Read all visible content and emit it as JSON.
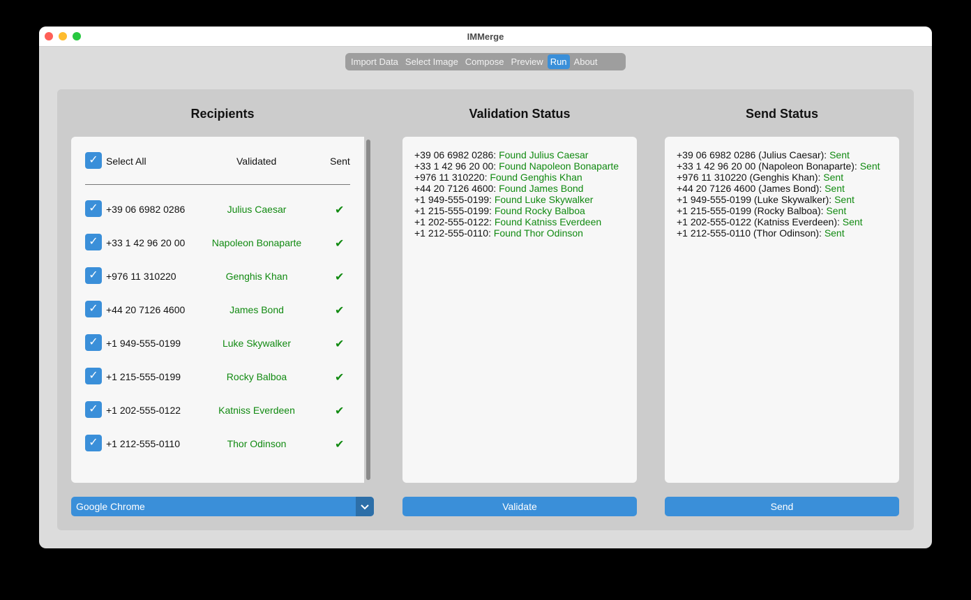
{
  "window": {
    "title": "IMMerge"
  },
  "tabs": [
    {
      "label": "Import Data",
      "active": false
    },
    {
      "label": "Select Image",
      "active": false
    },
    {
      "label": "Compose",
      "active": false
    },
    {
      "label": "Preview",
      "active": false
    },
    {
      "label": "Run",
      "active": true
    },
    {
      "label": "About",
      "active": false
    }
  ],
  "recipients": {
    "heading": "Recipients",
    "select_all_label": "Select All",
    "validated_header": "Validated",
    "sent_header": "Sent",
    "check_glyph": "✔",
    "rows": [
      {
        "phone": "+39 06 6982 0286",
        "name": "Julius Caesar"
      },
      {
        "phone": "+33 1 42 96 20 00",
        "name": "Napoleon Bonaparte"
      },
      {
        "phone": "+976 11 310220",
        "name": "Genghis Khan"
      },
      {
        "phone": "+44 20 7126 4600",
        "name": "James Bond"
      },
      {
        "phone": "+1 949-555-0199",
        "name": "Luke Skywalker"
      },
      {
        "phone": "+1 215-555-0199",
        "name": "Rocky Balboa"
      },
      {
        "phone": "+1 202-555-0122",
        "name": "Katniss Everdeen"
      },
      {
        "phone": "+1 212-555-0110",
        "name": "Thor Odinson"
      }
    ]
  },
  "validation": {
    "heading": "Validation Status",
    "lines": [
      {
        "prefix": "+39 06 6982 0286: ",
        "result": "Found Julius Caesar"
      },
      {
        "prefix": "+33 1 42 96 20 00: ",
        "result": "Found Napoleon Bonaparte"
      },
      {
        "prefix": "+976 11 310220: ",
        "result": "Found Genghis Khan"
      },
      {
        "prefix": "+44 20 7126 4600: ",
        "result": "Found James Bond"
      },
      {
        "prefix": "+1 949-555-0199: ",
        "result": "Found Luke Skywalker"
      },
      {
        "prefix": "+1 215-555-0199: ",
        "result": "Found Rocky Balboa"
      },
      {
        "prefix": "+1 202-555-0122: ",
        "result": "Found Katniss Everdeen"
      },
      {
        "prefix": "+1 212-555-0110: ",
        "result": "Found Thor Odinson"
      }
    ],
    "button_label": "Validate"
  },
  "send": {
    "heading": "Send Status",
    "lines": [
      {
        "prefix": "+39 06 6982 0286 (Julius Caesar): ",
        "result": "Sent"
      },
      {
        "prefix": "+33 1 42 96 20 00 (Napoleon Bonaparte): ",
        "result": "Sent"
      },
      {
        "prefix": "+976 11 310220 (Genghis Khan): ",
        "result": "Sent"
      },
      {
        "prefix": "+44 20 7126 4600 (James Bond): ",
        "result": "Sent"
      },
      {
        "prefix": "+1 949-555-0199 (Luke Skywalker): ",
        "result": "Sent"
      },
      {
        "prefix": "+1 215-555-0199 (Rocky Balboa): ",
        "result": "Sent"
      },
      {
        "prefix": "+1 202-555-0122 (Katniss Everdeen): ",
        "result": "Sent"
      },
      {
        "prefix": "+1 212-555-0110 (Thor Odinson): ",
        "result": "Sent"
      }
    ],
    "button_label": "Send"
  },
  "browser_select": {
    "value": "Google Chrome"
  },
  "colors": {
    "accent": "#3a8fd9",
    "success": "#118a11"
  }
}
